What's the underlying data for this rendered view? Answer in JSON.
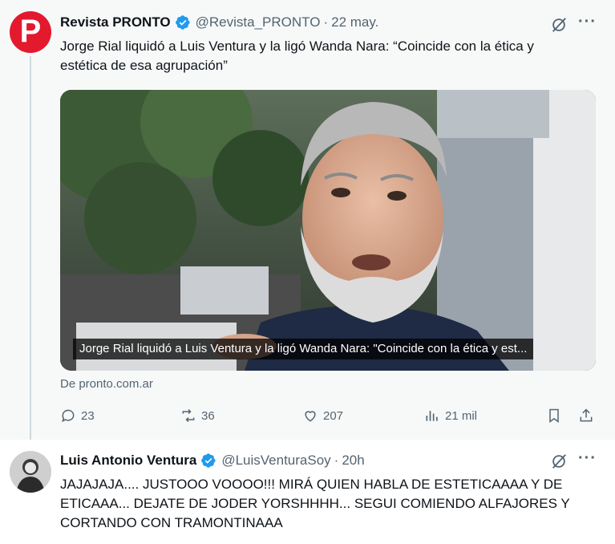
{
  "tweet1": {
    "display_name": "Revista PRONTO",
    "handle": "@Revista_PRONTO",
    "separator": "·",
    "time": "22 may.",
    "more_label": "···",
    "text_line1": "Jorge Rial liquidó a Luis Ventura y la ligó Wanda Nara: “Coincide con la ética y",
    "text_line2": "estética de esa agrupación”",
    "media_caption": "Jorge Rial liquidó a Luis Ventura y la ligó Wanda Nara: \"Coincide con la ética y est...",
    "source": "De pronto.com.ar",
    "replies": "23",
    "retweets": "36",
    "likes": "207",
    "views": "21 mil",
    "avatar_letter": "P",
    "avatar_color": "#e3192e"
  },
  "tweet2": {
    "display_name": "Luis Antonio Ventura",
    "handle": "@LuisVenturaSoy",
    "separator": "·",
    "time": "20h",
    "more_label": "···",
    "text_line1": "JAJAJAJA.... JUSTOOO VOOOO!!! MIRÁ QUIEN HABLA DE ESTETICAAAA Y DE",
    "text_line2": "ETICAAA... DEJATE DE JODER YORSHHHH... SEGUI COMIENDO ALFAJORES Y",
    "text_line3": "CORTANDO CON TRAMONTINAAA"
  },
  "colors": {
    "verified": "#1d9bf0",
    "muted": "#536471",
    "text": "#0f1419",
    "quoted_background": "#f7f9f9"
  }
}
